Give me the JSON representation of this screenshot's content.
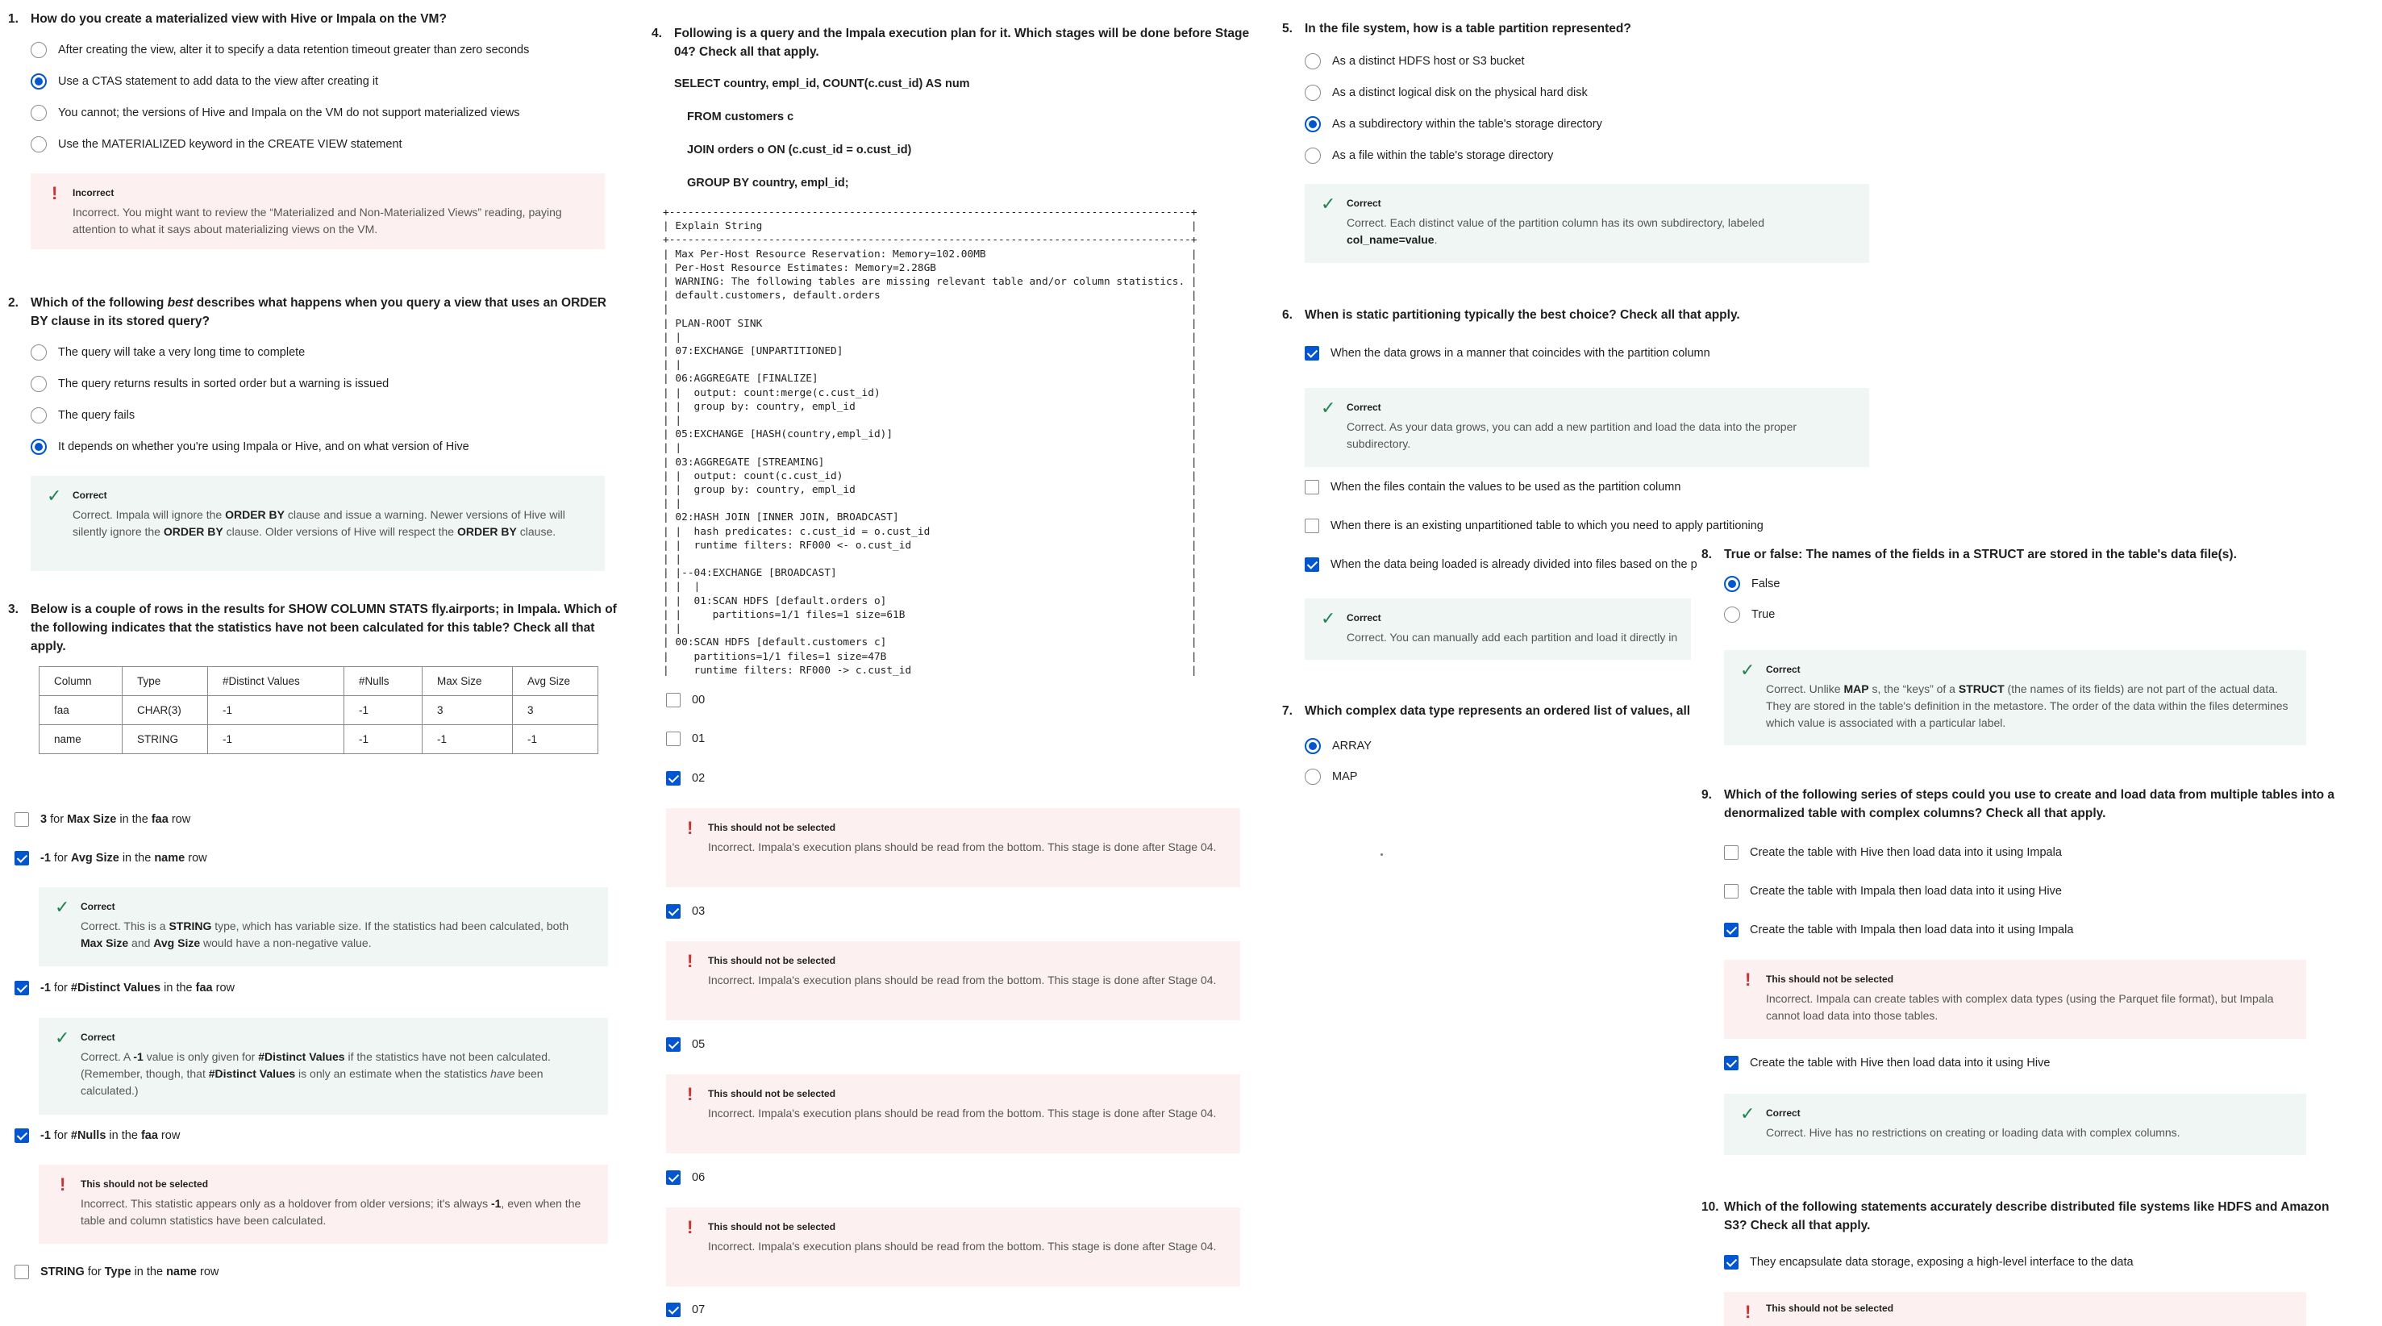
{
  "q1": {
    "num": "1.",
    "text": "How do you create a materialized view with Hive or Impala on the VM?",
    "options": [
      "After creating the view, alter it to specify a data retention timeout greater than zero seconds",
      "Use a CTAS statement to add data to the view after creating it",
      "You cannot; the versions of Hive and Impala on the VM do not support materialized views",
      "Use the MATERIALIZED keyword in the CREATE VIEW statement"
    ],
    "selected": 1,
    "feedback": {
      "title": "Incorrect",
      "text": "Incorrect. You might want to review the “Materialized and Non-Materialized Views” reading, paying attention to what it says about materializing views on the VM."
    }
  },
  "q2": {
    "num": "2.",
    "text_before": "Which of the following ",
    "text_em": "best",
    "text_after": " describes what happens when you query a view that uses an ORDER BY clause in its stored query?",
    "options": [
      "The query will take a very long time to complete",
      "The query returns results in sorted order but a warning is issued",
      "The query fails",
      "It depends on whether you're using Impala or Hive, and on what version of Hive"
    ],
    "selected": 3,
    "feedback": {
      "title": "Correct",
      "p1": "Correct. Impala will ignore the ",
      "b1": "ORDER BY",
      "p2": " clause and issue a warning. Newer versions of Hive will silently ignore the ",
      "b2": "ORDER BY",
      "p3": " clause. Older versions of Hive will respect the ",
      "b3": "ORDER BY",
      "p4": " clause."
    }
  },
  "q3": {
    "num": "3.",
    "text": "Below is a couple of rows in the results for SHOW COLUMN STATS fly.airports; in Impala. Which of the following indicates that the statistics have not been calculated for this table? Check all that apply.",
    "table": {
      "headers": [
        "Column",
        "Type",
        "#Distinct Values",
        "#Nulls",
        "Max Size",
        "Avg Size"
      ],
      "rows": [
        [
          "faa",
          "CHAR(3)",
          "-1",
          "-1",
          "3",
          "3"
        ],
        [
          "name",
          "STRING",
          "-1",
          "-1",
          "-1",
          "-1"
        ]
      ]
    },
    "options": [
      {
        "v": "3",
        "t1": " for ",
        "f": "Max Size",
        "t2": " in the ",
        "r": "faa",
        "t3": " row",
        "checked": false
      },
      {
        "v": "-1",
        "t1": " for ",
        "f": "Avg Size",
        "t2": " in the ",
        "r": "name",
        "t3": " row",
        "checked": true
      },
      {
        "v": "-1",
        "t1": " for ",
        "f": "#Distinct Values",
        "t2": " in the ",
        "r": "faa",
        "t3": " row",
        "checked": true
      },
      {
        "v": "-1",
        "t1": " for ",
        "f": "#Nulls",
        "t2": " in the ",
        "r": "faa",
        "t3": " row",
        "checked": true
      },
      {
        "v": "STRING",
        "t1": " for ",
        "f": "Type",
        "t2": " in the ",
        "r": "name",
        "t3": " row",
        "checked": false
      }
    ],
    "fb_avg": {
      "title": "Correct",
      "p1": "Correct. This is a ",
      "b1": "STRING",
      "p2": " type, which has variable size. If the statistics had been calculated, both ",
      "b2": "Max Size",
      "p3": " and ",
      "b3": "Avg Size",
      "p4": " would have a non-negative value."
    },
    "fb_distinct": {
      "title": "Correct",
      "p1": "Correct. A ",
      "b1": "-1",
      "p2": " value is only given for ",
      "b2": "#Distinct Values",
      "p3": " if the statistics have not been calculated. (Remember, though, that ",
      "b3": "#Distinct Values",
      "p4": " is only an estimate when the statistics ",
      "em": "have",
      "p5": " been calculated.)"
    },
    "fb_nulls": {
      "title": "This should not be selected",
      "p1": "Incorrect. This statistic appears only as a holdover from older versions; it's always ",
      "b1": "-1",
      "p2": ", even when the table and column statistics have been calculated."
    }
  },
  "q4": {
    "num": "4.",
    "text": "Following is a query and the Impala execution plan for it. Which stages will be done before Stage 04? Check all that apply.",
    "sql": [
      "SELECT country, empl_id, COUNT(c.cust_id) AS num",
      "FROM customers c",
      "JOIN orders o ON (c.cust_id = o.cust_id)",
      "GROUP BY country, empl_id;"
    ],
    "plan": "+------------------------------------------------------------------------------------+\n| Explain String                                                                     |\n+------------------------------------------------------------------------------------+\n| Max Per-Host Resource Reservation: Memory=102.00MB                                 |\n| Per-Host Resource Estimates: Memory=2.28GB                                         |\n| WARNING: The following tables are missing relevant table and/or column statistics. |\n| default.customers, default.orders                                                  |\n|                                                                                    |\n| PLAN-ROOT SINK                                                                     |\n| |                                                                                  |\n| 07:EXCHANGE [UNPARTITIONED]                                                        |\n| |                                                                                  |\n| 06:AGGREGATE [FINALIZE]                                                            |\n| |  output: count:merge(c.cust_id)                                                  |\n| |  group by: country, empl_id                                                      |\n| |                                                                                  |\n| 05:EXCHANGE [HASH(country,empl_id)]                                                |\n| |                                                                                  |\n| 03:AGGREGATE [STREAMING]                                                           |\n| |  output: count(c.cust_id)                                                        |\n| |  group by: country, empl_id                                                      |\n| |                                                                                  |\n| 02:HASH JOIN [INNER JOIN, BROADCAST]                                               |\n| |  hash predicates: c.cust_id = o.cust_id                                          |\n| |  runtime filters: RF000 <- o.cust_id                                             |\n| |                                                                                  |\n| |--04:EXCHANGE [BROADCAST]                                                         |\n| |  |                                                                               |\n| |  01:SCAN HDFS [default.orders o]                                                 |\n| |     partitions=1/1 files=1 size=61B                                              |\n| |                                                                                  |\n| 00:SCAN HDFS [default.customers c]                                                 |\n|    partitions=1/1 files=1 size=47B                                                 |\n|    runtime filters: RF000 -> c.cust_id                                             |",
    "options": [
      "00",
      "01",
      "02",
      "03",
      "05",
      "06",
      "07"
    ],
    "checked": [
      false,
      false,
      true,
      true,
      true,
      true,
      true
    ],
    "feedback": {
      "title": "This should not be selected",
      "text": "Incorrect. Impala's execution plans should be read from the bottom. This stage is done after Stage 04."
    }
  },
  "q5": {
    "num": "5.",
    "text": "In the file system, how is a table partition represented?",
    "options": [
      "As a distinct HDFS host or S3 bucket",
      "As a distinct logical disk on the physical hard disk",
      "As a subdirectory within the table's storage directory",
      "As a file within the table's storage directory"
    ],
    "selected": 2,
    "feedback": {
      "title": "Correct",
      "p1": "Correct. Each distinct value of the partition column has its own subdirectory, labeled ",
      "b1": "col_name=value",
      "p2": "."
    }
  },
  "q6": {
    "num": "6.",
    "text": "When is static partitioning typically the best choice? Check all that apply.",
    "options": [
      "When the data grows in a manner that coincides with the partition column",
      "When the files contain the values to be used as the partition column",
      "When there is an existing unpartitioned table to which you need to apply partitioning",
      "When the data being loaded is already divided into files based on the p"
    ],
    "checked": [
      true,
      false,
      false,
      true
    ],
    "fb1": {
      "title": "Correct",
      "text": "Correct. As your data grows, you can add a new partition and load the data into the proper subdirectory."
    },
    "fb2": {
      "title": "Correct",
      "text": "Correct. You can manually add each partition and load it directly in"
    }
  },
  "q7": {
    "num": "7.",
    "text": "Which complex data type represents an ordered list of values, all havi",
    "options": [
      "ARRAY",
      "MAP"
    ],
    "selected": 0
  },
  "q8": {
    "num": "8.",
    "text": "True or false: The names of the fields in a STRUCT are stored in the table's data file(s).",
    "options": [
      "False",
      "True"
    ],
    "selected": 0,
    "feedback": {
      "title": "Correct",
      "p1": "Correct. Unlike ",
      "b1": "MAP",
      "p2": " s, the “keys” of a ",
      "b2": "STRUCT",
      "p3": " (the names of its fields) are not part of the actual data. They are stored in the table's definition in the metastore. The order of the data within the files determines which value is associated with a particular label."
    }
  },
  "q9": {
    "num": "9.",
    "text": "Which of the following series of steps could you use to create and load data from multiple tables into a denormalized table with complex columns? Check all that apply.",
    "options": [
      "Create the table with Hive then load data into it using Impala",
      "Create the table with Impala then load data into it using Hive",
      "Create the table with Impala then load data into it using Impala",
      "Create the table with Hive then load data into it using Hive"
    ],
    "checked": [
      false,
      false,
      true,
      true
    ],
    "fb_bad": {
      "title": "This should not be selected",
      "text": "Incorrect. Impala can create tables with complex data types (using the Parquet file format), but Impala cannot load data into those tables."
    },
    "fb_ok": {
      "title": "Correct",
      "text": "Correct. Hive has no restrictions on creating or loading data with complex columns."
    }
  },
  "q10": {
    "num": "10.",
    "text": "Which of the following statements accurately describe distributed file systems like HDFS and Amazon S3? Check all that apply.",
    "options": [
      "They encapsulate data storage, exposing a high-level interface to the data"
    ],
    "checked": [
      true
    ],
    "fb_title": "This should not be selected"
  },
  "colors": {
    "accent": "#0056d2",
    "correct_bg": "#f0f6f3",
    "correct_icon": "#1f8354",
    "incorrect_bg": "#fdf0f0",
    "incorrect_icon": "#d32f2f"
  }
}
